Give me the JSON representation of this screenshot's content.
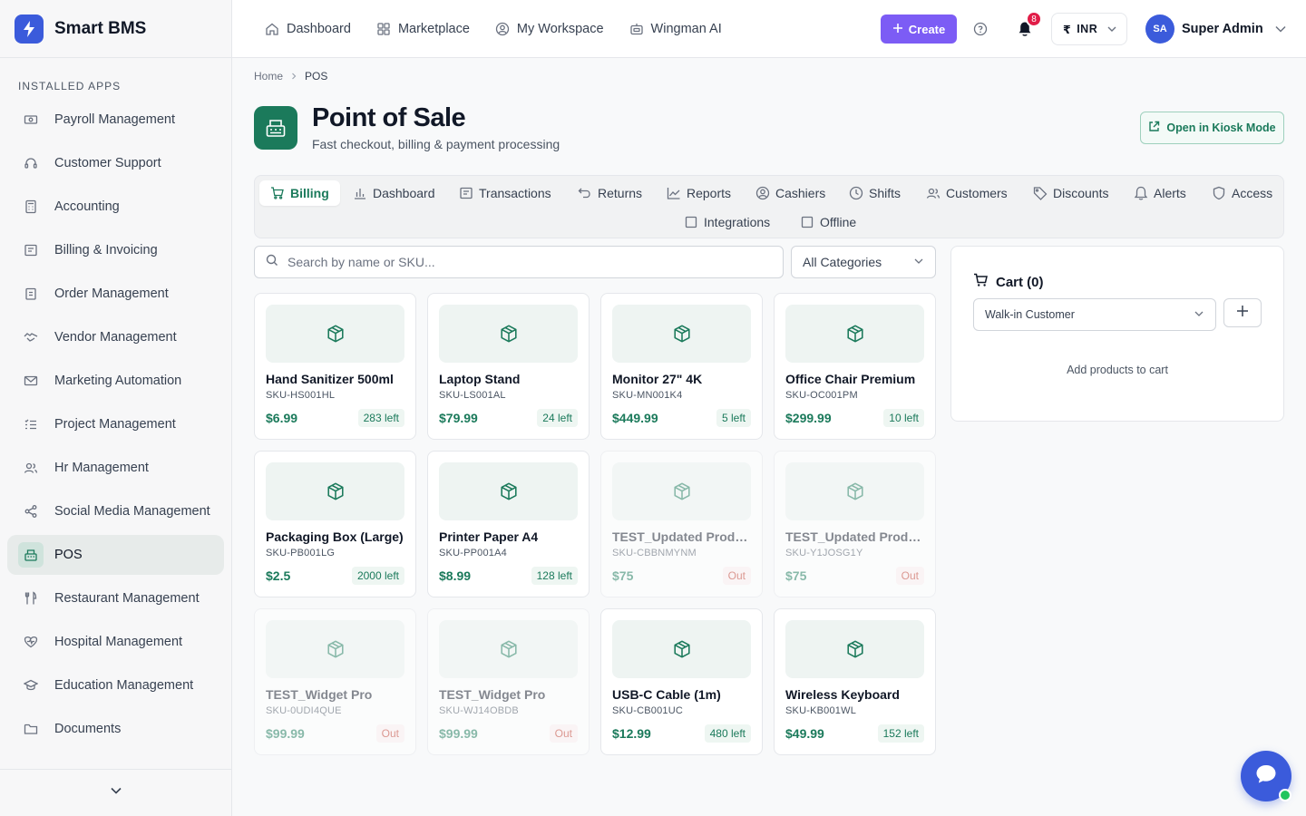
{
  "app": {
    "name": "Smart BMS"
  },
  "sidebar": {
    "section_label": "INSTALLED APPS",
    "items": [
      {
        "label": "Payroll Management",
        "icon": "payroll-icon"
      },
      {
        "label": "Customer Support",
        "icon": "headset-icon"
      },
      {
        "label": "Accounting",
        "icon": "calculator-icon"
      },
      {
        "label": "Billing & Invoicing",
        "icon": "receipt-icon"
      },
      {
        "label": "Order Management",
        "icon": "clipboard-icon"
      },
      {
        "label": "Vendor Management",
        "icon": "handshake-icon"
      },
      {
        "label": "Marketing Automation",
        "icon": "mail-icon"
      },
      {
        "label": "Project Management",
        "icon": "list-check-icon"
      },
      {
        "label": "Hr Management",
        "icon": "users-icon"
      },
      {
        "label": "Social Media Management",
        "icon": "share-icon"
      },
      {
        "label": "POS",
        "icon": "register-icon",
        "active": true
      },
      {
        "label": "Restaurant Management",
        "icon": "utensils-icon"
      },
      {
        "label": "Hospital Management",
        "icon": "heart-pulse-icon"
      },
      {
        "label": "Education Management",
        "icon": "graduation-cap-icon"
      },
      {
        "label": "Documents",
        "icon": "folder-icon"
      }
    ]
  },
  "topnav": {
    "items": [
      {
        "label": "Dashboard",
        "icon": "home-icon"
      },
      {
        "label": "Marketplace",
        "icon": "grid-icon"
      },
      {
        "label": "My Workspace",
        "icon": "user-circle-icon"
      },
      {
        "label": "Wingman AI",
        "icon": "bot-icon"
      }
    ],
    "create_label": "Create",
    "notifications_count": "8",
    "currency_symbol": "₹",
    "currency": "INR",
    "user_initials": "SA",
    "user_name": "Super Admin"
  },
  "breadcrumb": {
    "home": "Home",
    "current": "POS"
  },
  "page": {
    "title": "Point of Sale",
    "subtitle": "Fast checkout, billing & payment processing",
    "kiosk_label": "Open in Kiosk Mode"
  },
  "tabs": [
    {
      "label": "Billing",
      "icon": "cart-icon",
      "active": true
    },
    {
      "label": "Dashboard",
      "icon": "bar-chart-icon"
    },
    {
      "label": "Transactions",
      "icon": "receipt-icon"
    },
    {
      "label": "Returns",
      "icon": "undo-icon"
    },
    {
      "label": "Reports",
      "icon": "trend-icon"
    },
    {
      "label": "Cashiers",
      "icon": "user-circle-icon"
    },
    {
      "label": "Shifts",
      "icon": "clock-icon"
    },
    {
      "label": "Customers",
      "icon": "users-icon"
    },
    {
      "label": "Discounts",
      "icon": "tag-icon"
    },
    {
      "label": "Alerts",
      "icon": "bell-icon"
    },
    {
      "label": "Access",
      "icon": "shield-icon"
    },
    {
      "label": "Integrations",
      "icon": "square-icon"
    },
    {
      "label": "Offline",
      "icon": "square-icon"
    }
  ],
  "search": {
    "placeholder": "Search by name or SKU...",
    "category": "All Categories"
  },
  "products": [
    {
      "name": "Hand Sanitizer 500ml",
      "sku": "SKU-HS001HL",
      "price": "$6.99",
      "stock": "283 left",
      "in_stock": true
    },
    {
      "name": "Laptop Stand",
      "sku": "SKU-LS001AL",
      "price": "$79.99",
      "stock": "24 left",
      "in_stock": true
    },
    {
      "name": "Monitor 27\" 4K",
      "sku": "SKU-MN001K4",
      "price": "$449.99",
      "stock": "5 left",
      "in_stock": true
    },
    {
      "name": "Office Chair Premium",
      "sku": "SKU-OC001PM",
      "price": "$299.99",
      "stock": "10 left",
      "in_stock": true
    },
    {
      "name": "Packaging Box (Large)",
      "sku": "SKU-PB001LG",
      "price": "$2.5",
      "stock": "2000 left",
      "in_stock": true
    },
    {
      "name": "Printer Paper A4",
      "sku": "SKU-PP001A4",
      "price": "$8.99",
      "stock": "128 left",
      "in_stock": true
    },
    {
      "name": "TEST_Updated Product",
      "sku": "SKU-CBBNMYNM",
      "price": "$75",
      "stock": "Out",
      "in_stock": false
    },
    {
      "name": "TEST_Updated Product",
      "sku": "SKU-Y1JOSG1Y",
      "price": "$75",
      "stock": "Out",
      "in_stock": false
    },
    {
      "name": "TEST_Widget Pro",
      "sku": "SKU-0UDI4QUE",
      "price": "$99.99",
      "stock": "Out",
      "in_stock": false
    },
    {
      "name": "TEST_Widget Pro",
      "sku": "SKU-WJ14OBDB",
      "price": "$99.99",
      "stock": "Out",
      "in_stock": false
    },
    {
      "name": "USB-C Cable (1m)",
      "sku": "SKU-CB001UC",
      "price": "$12.99",
      "stock": "480 left",
      "in_stock": true
    },
    {
      "name": "Wireless Keyboard",
      "sku": "SKU-KB001WL",
      "price": "$49.99",
      "stock": "152 left",
      "in_stock": true
    }
  ],
  "cart": {
    "title": "Cart (0)",
    "customer": "Walk-in Customer",
    "empty_message": "Add products to cart"
  },
  "colors": {
    "brand": "#3b5bdb",
    "accent": "#1b7a5b",
    "create": "#7c5cf5",
    "badge": "#e11d48"
  }
}
